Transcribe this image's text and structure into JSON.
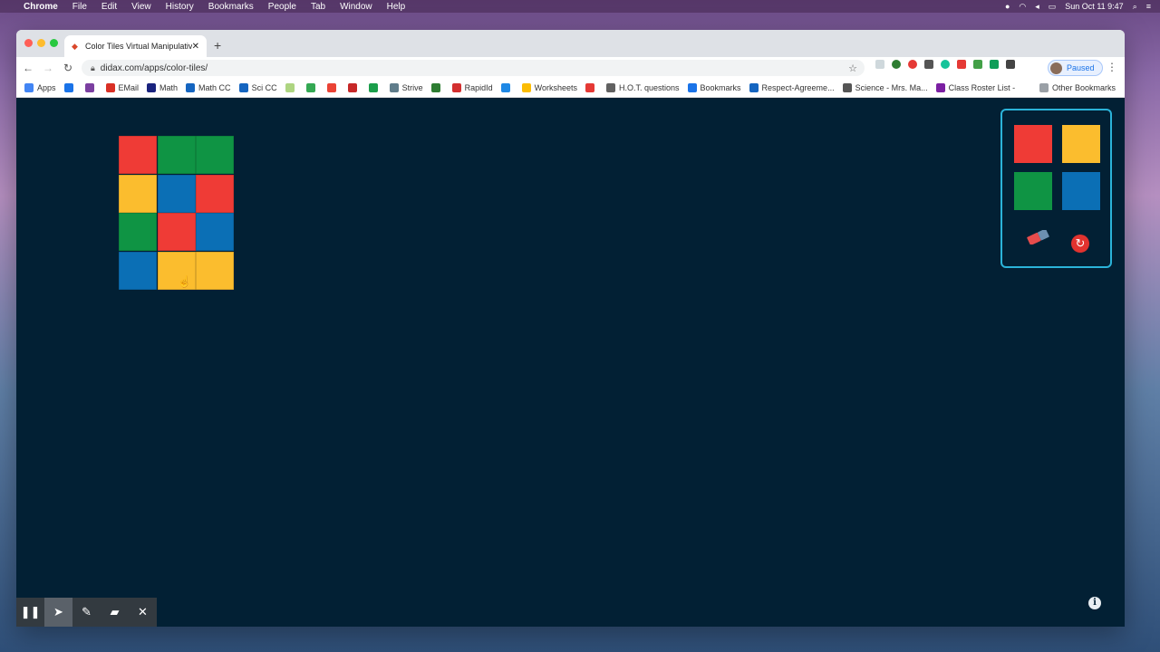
{
  "menubar": {
    "app": "Chrome",
    "items": [
      "File",
      "Edit",
      "View",
      "History",
      "Bookmarks",
      "People",
      "Tab",
      "Window",
      "Help"
    ],
    "clock": "Sun Oct 11 9:47"
  },
  "browser": {
    "tab_title": "Color Tiles Virtual Manipulative",
    "url": "didax.com/apps/color-tiles/",
    "profile_label": "Paused"
  },
  "bookmarks": [
    {
      "label": "Apps",
      "color": "#4285f4"
    },
    {
      "label": "",
      "color": "#1a73e8"
    },
    {
      "label": "",
      "color": "#7b3fa0"
    },
    {
      "label": "EMail",
      "color": "#d93025"
    },
    {
      "label": "Math",
      "color": "#1a237e"
    },
    {
      "label": "Math CC",
      "color": "#1565c0"
    },
    {
      "label": "Sci CC",
      "color": "#1565c0"
    },
    {
      "label": "",
      "color": "#aed581"
    },
    {
      "label": "",
      "color": "#34a853"
    },
    {
      "label": "",
      "color": "#ea4335"
    },
    {
      "label": "",
      "color": "#c62828"
    },
    {
      "label": "",
      "color": "#1b9e4b"
    },
    {
      "label": "Strive",
      "color": "#607d8b"
    },
    {
      "label": "",
      "color": "#2e7d32"
    },
    {
      "label": "RapidId",
      "color": "#d32f2f"
    },
    {
      "label": "",
      "color": "#1e88e5"
    },
    {
      "label": "Worksheets",
      "color": "#fbbc04"
    },
    {
      "label": "",
      "color": "#e53935"
    },
    {
      "label": "H.O.T. questions",
      "color": "#616161"
    },
    {
      "label": "Bookmarks",
      "color": "#1a73e8"
    },
    {
      "label": "Respect-Agreeme...",
      "color": "#1565c0"
    },
    {
      "label": "Science - Mrs. Ma...",
      "color": "#555555"
    },
    {
      "label": "Class Roster List -",
      "color": "#7b1fa2"
    }
  ],
  "other_bookmarks": "Other Bookmarks",
  "tiles": {
    "colors": {
      "red": "#ef3b36",
      "green": "#0f9444",
      "yellow": "#fbbd2e",
      "blue": "#0b6fb5"
    },
    "grid": [
      [
        "red",
        "green",
        "green"
      ],
      [
        "yellow",
        "blue",
        "red"
      ],
      [
        "green",
        "red",
        "blue"
      ],
      [
        "blue",
        "yellow",
        "yellow"
      ]
    ]
  },
  "palette": {
    "swatches": [
      "red",
      "yellow",
      "green",
      "blue"
    ],
    "eraser_icon": "eraser-icon",
    "reset_icon": "reset-icon"
  },
  "info_label": "i",
  "draw_toolbar": {
    "tools": [
      "pause-icon",
      "pointer-icon",
      "pencil-icon",
      "eraser-icon",
      "close-icon"
    ],
    "active": "pointer-icon"
  }
}
